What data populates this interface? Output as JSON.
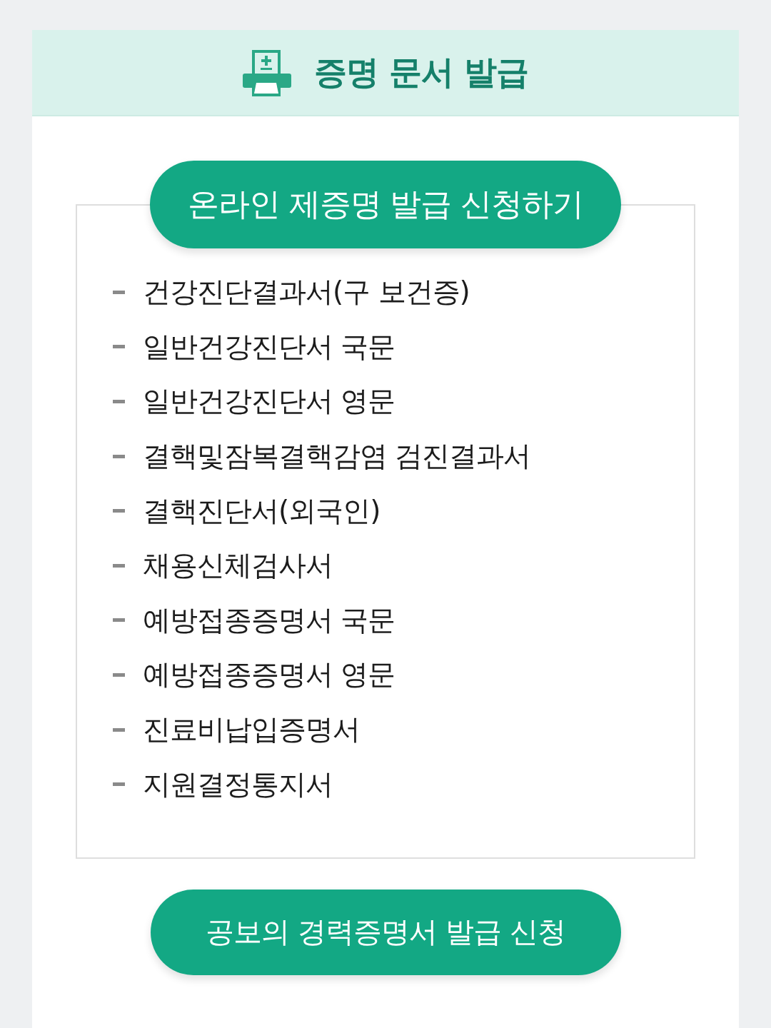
{
  "header": {
    "title": "증명 문서 발급"
  },
  "online_section": {
    "button": "온라인 제증명 발급 신청하기",
    "items": [
      "건강진단결과서(구 보건증)",
      "일반건강진단서 국문",
      "일반건강진단서 영문",
      "결핵및잠복결핵감염 검진결과서",
      "결핵진단서(외국인)",
      "채용신체검사서",
      "예방접종증명서 국문",
      "예방접종증명서 영문",
      "진료비납입증명서",
      "지원결정통지서"
    ]
  },
  "career_button": "공보의 경력증명서 발급 신청"
}
